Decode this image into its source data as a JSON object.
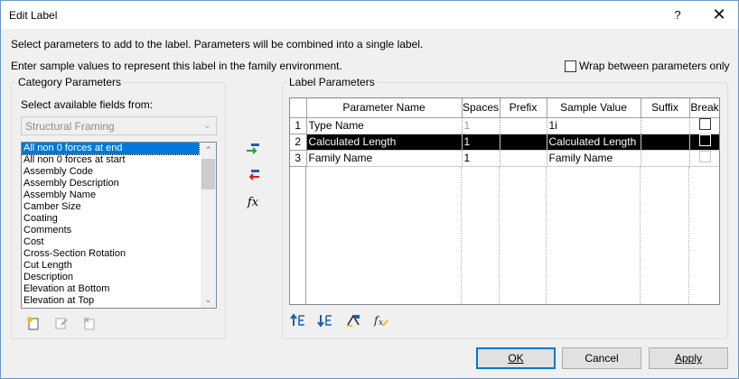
{
  "window": {
    "title": "Edit Label",
    "help_label": "?",
    "close_label": "✕"
  },
  "intro": {
    "line1": "Select parameters to add to the label.  Parameters will be combined into a single label.",
    "line2": "Enter sample values to represent this label in the family environment.",
    "wrap_label": "Wrap between parameters only",
    "wrap_checked": false
  },
  "category": {
    "group_label": "Category Parameters",
    "select_label": "Select available fields from:",
    "combo_value": "Structural Framing",
    "items": [
      "All non 0 forces at end",
      "All non 0 forces at start",
      "Assembly Code",
      "Assembly Description",
      "Assembly Name",
      "Camber Size",
      "Coating",
      "Comments",
      "Cost",
      "Cross-Section Rotation",
      "Cut Length",
      "Description",
      "Elevation at Bottom",
      "Elevation at Top"
    ],
    "selected_index": 0,
    "tool_icons": [
      "new-parameter-icon",
      "edit-parameter-icon",
      "delete-parameter-icon"
    ]
  },
  "middle_icons": {
    "add": "add-parameter-to-label-icon",
    "remove": "remove-parameter-from-label-icon",
    "fx_label": "fx"
  },
  "label": {
    "group_label": "Label Parameters",
    "columns": [
      "Parameter Name",
      "Spaces",
      "Prefix",
      "Sample Value",
      "Suffix",
      "Break"
    ],
    "rows": [
      {
        "num": "1",
        "name": "Type Name",
        "spaces": "1",
        "prefix": "",
        "sample": "1i",
        "suffix": "",
        "break_checked": false
      },
      {
        "num": "2",
        "name": "Calculated Length",
        "spaces": "1",
        "prefix": "",
        "sample": "Calculated Length",
        "suffix": "",
        "break_checked": false
      },
      {
        "num": "3",
        "name": "Family Name",
        "spaces": "1",
        "prefix": "",
        "sample": "Family Name",
        "suffix": "",
        "break_checked": false
      }
    ],
    "selected_row": 1,
    "tool_icons": [
      "move-up-icon",
      "move-down-icon",
      "edit-format-icon",
      "edit-formula-icon"
    ]
  },
  "buttons": {
    "ok": "OK",
    "cancel": "Cancel",
    "apply": "Apply"
  },
  "colors": {
    "selection": "#0078d7",
    "green_arrow": "#2e9e3a",
    "red_arrow": "#d0202a",
    "blue_icon": "#1e5fb5"
  }
}
